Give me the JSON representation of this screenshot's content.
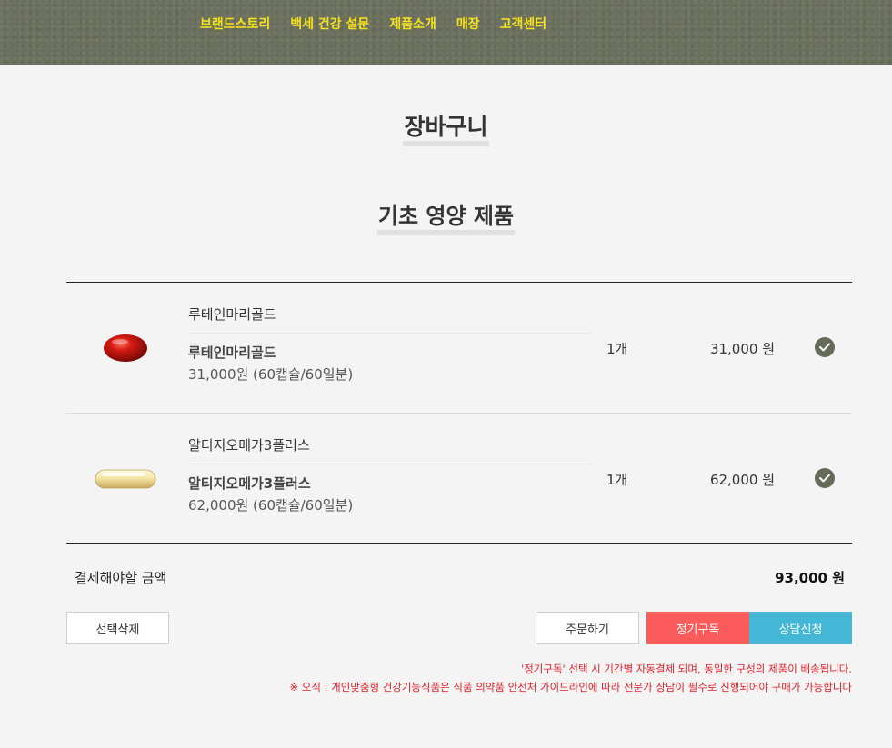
{
  "nav": {
    "items": [
      "브랜드스토리",
      "백세 건강 설문",
      "제품소개",
      "매장",
      "고객센터"
    ],
    "color": "#f5e31b",
    "background": "#6a6e5b"
  },
  "page": {
    "title": "장바구니",
    "section_title": "기초 영양 제품"
  },
  "cart": {
    "items": [
      {
        "name_top": "루테인마리골드",
        "name": "루테인마리골드",
        "desc": "31,000원 (60캡슐/60일분)",
        "qty": "1개",
        "price": "31,000 원",
        "image": "red-softgel-capsule",
        "checked": true
      },
      {
        "name_top": "알티지오메가3플러스",
        "name": "알티지오메가3플러스",
        "desc": "62,000원 (60캡슐/60일분)",
        "qty": "1개",
        "price": "62,000 원",
        "image": "clear-omega-softgel-capsule",
        "checked": true
      }
    ]
  },
  "summary": {
    "total_label": "결제해야할 금액",
    "total_value": "93,000 원"
  },
  "buttons": {
    "delete": "선택삭제",
    "order": "주문하기",
    "subscribe": "정기구독",
    "consult": "상담신청",
    "subscribe_color": "#fb5b5b",
    "consult_color": "#45b7d6"
  },
  "notices": {
    "line1": "'정기구독' 선택 시 기간별 자동결제 되며, 동일한 구성의 제품이 배송됩니다.",
    "line2": "※ 오직 : 개인맞춤형 건강기능식품은 식품 의약품 안전처 가이드라인에 따라 전문가 상담이 필수로 진행되어야 구매가 가능합니다",
    "color": "#e0202a"
  }
}
